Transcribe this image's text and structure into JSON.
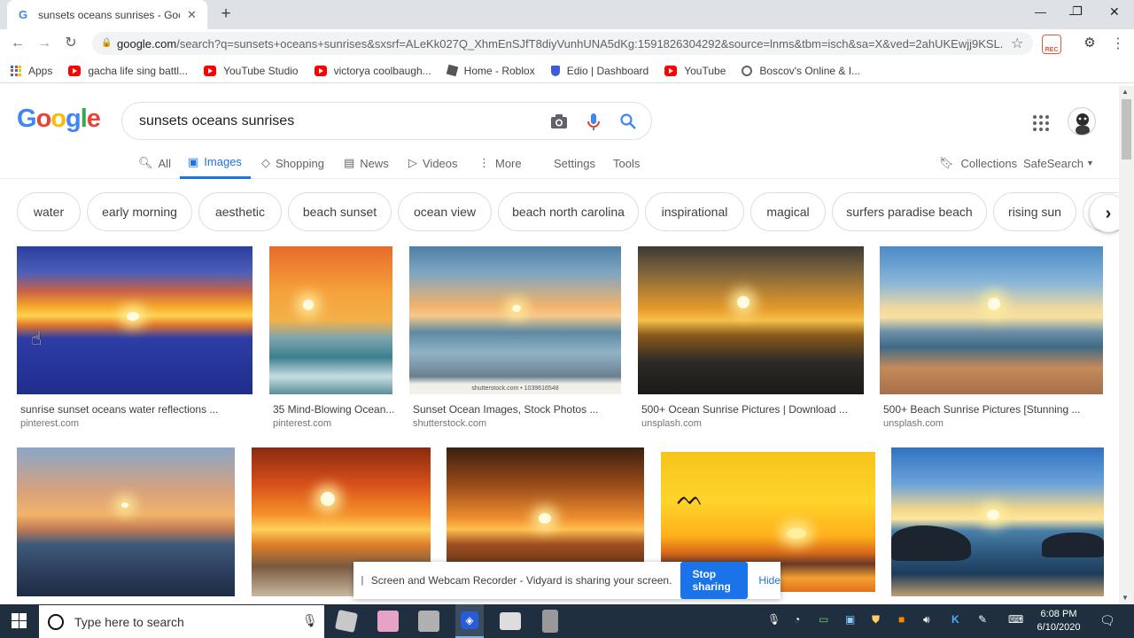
{
  "browser": {
    "tab_title": "sunsets oceans sunrises - Google",
    "tab_favicon": "G",
    "url_host": "google.com",
    "url_rest": "/search?q=sunsets+oceans+sunrises&sxsrf=ALeKk027Q_XhmEnSJfT8diyVunhUNA5dKg:1591826304292&source=lnms&tbm=isch&sa=X&ved=2ahUKEwjj9KSL...",
    "rec_label": "REC"
  },
  "bookmarks": [
    {
      "label": "Apps",
      "icon": "apps-grid-icon"
    },
    {
      "label": "gacha life sing battl...",
      "icon": "youtube-icon"
    },
    {
      "label": "YouTube Studio",
      "icon": "youtube-icon"
    },
    {
      "label": "victorya coolbaugh...",
      "icon": "youtube-icon"
    },
    {
      "label": "Home - Roblox",
      "icon": "roblox-icon"
    },
    {
      "label": "Edio | Dashboard",
      "icon": "shield-icon"
    },
    {
      "label": "YouTube",
      "icon": "youtube-icon"
    },
    {
      "label": "Boscov's Online & I...",
      "icon": "globe-icon"
    }
  ],
  "search": {
    "query": "sunsets oceans sunrises"
  },
  "nav": {
    "all": "All",
    "images": "Images",
    "shopping": "Shopping",
    "news": "News",
    "videos": "Videos",
    "more": "More",
    "settings": "Settings",
    "tools": "Tools",
    "collections": "Collections",
    "safesearch": "SafeSearch"
  },
  "chips": [
    "water",
    "early morning",
    "aesthetic",
    "beach sunset",
    "ocean view",
    "beach north carolina",
    "inspirational",
    "magical",
    "surfers paradise beach",
    "rising sun"
  ],
  "results": [
    {
      "caption": "sunrise sunset oceans water reflections ...",
      "source": "pinterest.com"
    },
    {
      "caption": "35 Mind-Blowing Ocean...",
      "source": "pinterest.com"
    },
    {
      "caption": "Sunset Ocean Images, Stock Photos ...",
      "source": "shutterstock.com",
      "watermark": "shutterstock.com • 1039616548"
    },
    {
      "caption": "500+ Ocean Sunrise Pictures | Download ...",
      "source": "unsplash.com"
    },
    {
      "caption": "500+ Beach Sunrise Pictures [Stunning ...",
      "source": "unsplash.com"
    }
  ],
  "sharebar": {
    "message": "Screen and Webcam Recorder - Vidyard is sharing your screen.",
    "stop": "Stop sharing",
    "hide": "Hide"
  },
  "taskbar": {
    "search_placeholder": "Type here to search",
    "time": "6:08 PM",
    "date": "6/10/2020"
  },
  "colors": {
    "accent": "#1a73e8",
    "taskbar": "#1f2f3f"
  }
}
